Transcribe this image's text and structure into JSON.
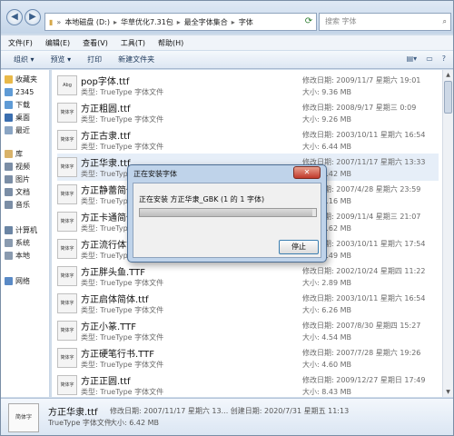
{
  "address": {
    "segments": [
      "本地磁盘 (D:)",
      "华草优化7.31包",
      "最全字体集合",
      "字体"
    ],
    "search_placeholder": "搜索 字体"
  },
  "menu": [
    "文件(F)",
    "编辑(E)",
    "查看(V)",
    "工具(T)",
    "帮助(H)"
  ],
  "toolbar": {
    "organize": "组织 ▾",
    "preview": "预览 ▾",
    "print": "打印",
    "new_folder": "新建文件夹"
  },
  "navpane": [
    {
      "label": "收藏夹",
      "color": "#e9b949"
    },
    {
      "label": "2345",
      "color": "#5f9bd6"
    },
    {
      "label": "下载",
      "color": "#5f9bd6"
    },
    {
      "label": "桌面",
      "color": "#3b6fb0"
    },
    {
      "label": "最近",
      "color": "#8aa5c4"
    },
    {
      "label": "库",
      "color": "#d9b36a"
    },
    {
      "label": "视频",
      "color": "#7b8ea6"
    },
    {
      "label": "图片",
      "color": "#7b8ea6"
    },
    {
      "label": "文档",
      "color": "#7b8ea6"
    },
    {
      "label": "音乐",
      "color": "#7b8ea6"
    },
    {
      "label": "计算机",
      "color": "#6b85a4"
    },
    {
      "label": "系统",
      "color": "#8a9bb0"
    },
    {
      "label": "本地",
      "color": "#8a9bb0"
    },
    {
      "label": "网络",
      "color": "#5a8ac6"
    }
  ],
  "files": [
    {
      "name": "pop字体.ttf",
      "type": "类型: TrueType 字体文件",
      "date": "修改日期: 2009/11/7 星期六 19:01",
      "size": "大小: 9.36 MB",
      "thumb": "Abg"
    },
    {
      "name": "方正粗圆.ttf",
      "type": "类型: TrueType 字体文件",
      "date": "修改日期: 2008/9/17 星期三 0:09",
      "size": "大小: 9.26 MB",
      "thumb": "简体字"
    },
    {
      "name": "方正古隶.ttf",
      "type": "类型: TrueType 字体文件",
      "date": "修改日期: 2003/10/11 星期六 16:54",
      "size": "大小: 6.44 MB",
      "thumb": "简体字"
    },
    {
      "name": "方正华隶.ttf",
      "type": "类型: TrueType 字体文件",
      "date": "修改日期: 2007/11/17 星期六 13:33",
      "size": "大小: 6.42 MB",
      "thumb": "简体字"
    },
    {
      "name": "方正静蕾简体",
      "type": "类型: TrueType 字体文件",
      "date": "修改日期: 2007/4/28 星期六 23:59",
      "size": "大小: 4.16 MB",
      "thumb": "简体字"
    },
    {
      "name": "方正卡通简体",
      "type": "类型: TrueType 字体文件",
      "date": "修改日期: 2009/11/4 星期三 21:07",
      "size": "大小: 1.62 MB",
      "thumb": "简体字"
    },
    {
      "name": "方正流行体简",
      "type": "类型: TrueType 字体文件",
      "date": "修改日期: 2003/10/11 星期六 17:54",
      "size": "大小: 3.49 MB",
      "thumb": "简体字"
    },
    {
      "name": "方正胖头鱼.TTF",
      "type": "类型: TrueType 字体文件",
      "date": "修改日期: 2002/10/24 星期四 11:22",
      "size": "大小: 2.89 MB",
      "thumb": "简体字"
    },
    {
      "name": "方正启体简体.ttf",
      "type": "类型: TrueType 字体文件",
      "date": "修改日期: 2003/10/11 星期六 16:54",
      "size": "大小: 6.26 MB",
      "thumb": "简体字"
    },
    {
      "name": "方正小篆.TTF",
      "type": "类型: TrueType 字体文件",
      "date": "修改日期: 2007/8/30 星期四 15:27",
      "size": "大小: 4.54 MB",
      "thumb": "简体字"
    },
    {
      "name": "方正硬笔行书.TTF",
      "type": "类型: TrueType 字体文件",
      "date": "修改日期: 2007/7/28 星期六 19:26",
      "size": "大小: 4.60 MB",
      "thumb": "简体字"
    },
    {
      "name": "方正正圆.ttf",
      "type": "类型: TrueType 字体文件",
      "date": "修改日期: 2009/12/27 星期日 17:49",
      "size": "大小: 8.43 MB",
      "thumb": "简体字"
    }
  ],
  "details": {
    "name": "方正华隶.ttf",
    "thumb": "简体字",
    "meta1": "修改日期: 2007/11/17 星期六 13...  创建日期: 2020/7/31 星期五 11:13",
    "type": "TrueType 字体文件",
    "meta2": "大小: 6.42 MB"
  },
  "dialog": {
    "title": "正在安装字体",
    "close": "✕",
    "message": "正在安装 方正华隶_GBK (1 的 1 字体)",
    "progress": 0.98,
    "stop_label": "停止"
  }
}
